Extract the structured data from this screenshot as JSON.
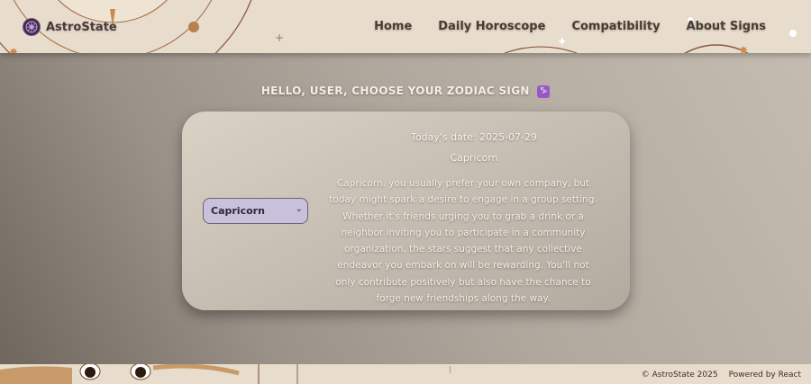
{
  "brand": {
    "name": "AstroState"
  },
  "nav": [
    {
      "label": "Home"
    },
    {
      "label": "Daily Horoscope"
    },
    {
      "label": "Compatibility"
    },
    {
      "label": "About Signs"
    }
  ],
  "main": {
    "heading": "HELLO, USER, CHOOSE YOUR ZODIAC SIGN",
    "heading_icon": "♑",
    "select": {
      "value": "Capricorn",
      "arrow": "⌄"
    },
    "date_line": "Today's date: 2025-07-29",
    "sign_name": "Capricorn",
    "horoscope": "Capricorn, you usually prefer your own company, but today might spark a desire to engage in a group setting. Whether it's friends urging you to grab a drink or a neighbor inviting you to participate in a community organization, the stars suggest that any collective endeavor you embark on will be rewarding. You'll not only contribute positively but also have the chance to forge new friendships along the way."
  },
  "footer": {
    "copyright": "© AstroState 2025",
    "powered": "Powered by React"
  },
  "colors": {
    "header_bg": "#e8dccc",
    "accent_purple": "#9a58c8",
    "select_bg": "#c7c1dc"
  }
}
